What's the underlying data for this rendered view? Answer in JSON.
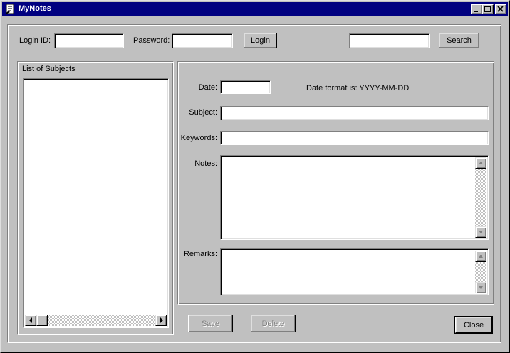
{
  "window": {
    "title": "MyNotes",
    "icon": "notes-app-icon",
    "controls": [
      "minimize-icon",
      "maximize-icon",
      "close-icon"
    ]
  },
  "login": {
    "login_id_label": "Login ID:",
    "login_id_value": "",
    "password_label": "Password:",
    "password_value": "",
    "login_button": "Login"
  },
  "search": {
    "query": "",
    "button": "Search"
  },
  "subjects": {
    "group_label": "List of Subjects",
    "items": []
  },
  "form": {
    "date_label": "Date:",
    "date_value": "",
    "date_hint": "Date format is: YYYY-MM-DD",
    "subject_label": "Subject:",
    "subject_value": "",
    "keywords_label": "Keywords:",
    "keywords_value": "",
    "notes_label": "Notes:",
    "notes_value": "",
    "remarks_label": "Remarks:",
    "remarks_value": ""
  },
  "actions": {
    "save": "Save",
    "delete": "Delete",
    "close": "Close"
  }
}
